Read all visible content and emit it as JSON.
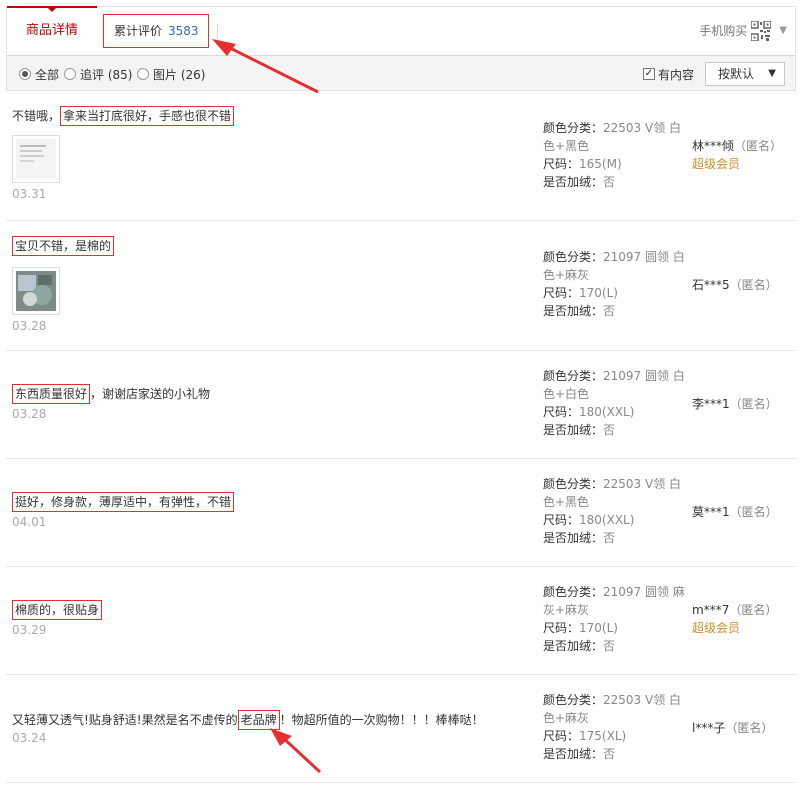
{
  "tabs": {
    "detail_label": "商品详情",
    "review_label": "累计评价",
    "review_count": "3583",
    "mobile_buy": "手机购买"
  },
  "filters": {
    "all": "全部",
    "append": "追评 (85)",
    "pictures": "图片 (26)",
    "has_content": "有内容",
    "sort": "按默认",
    "all_selected": true,
    "has_content_checked": true
  },
  "reviews": [
    {
      "pre": "不错哦，",
      "hl": "拿来当打底很好，手感也很不错",
      "post": "",
      "date": "03.31",
      "color_label": "颜色分类：",
      "color_value": "22503 V领 白色+黑色",
      "size_label": "尺码：",
      "size_value": "165(M)",
      "fleece_label": "是否加绒：",
      "fleece_value": "否",
      "user": "林***倾",
      "anon": "（匿名）",
      "vip": "超级会员"
    },
    {
      "pre": "",
      "hl": "宝贝不错，是棉的",
      "post": "",
      "date": "03.28",
      "color_label": "颜色分类：",
      "color_value": "21097 圆领 白色+麻灰",
      "size_label": "尺码：",
      "size_value": "170(L)",
      "fleece_label": "是否加绒：",
      "fleece_value": "否",
      "user": "石***5",
      "anon": "（匿名）",
      "vip": ""
    },
    {
      "pre": "",
      "hl": "东西质量很好",
      "post": "，谢谢店家送的小礼物",
      "date": "03.28",
      "color_label": "颜色分类：",
      "color_value": "21097 圆领 白色+白色",
      "size_label": "尺码：",
      "size_value": "180(XXL)",
      "fleece_label": "是否加绒：",
      "fleece_value": "否",
      "user": "李***1",
      "anon": "（匿名）",
      "vip": ""
    },
    {
      "pre": "",
      "hl": "挺好，修身款，薄厚适中，有弹性，不错",
      "post": "",
      "date": "04.01",
      "color_label": "颜色分类：",
      "color_value": "22503 V领 白色+黑色",
      "size_label": "尺码：",
      "size_value": "180(XXL)",
      "fleece_label": "是否加绒：",
      "fleece_value": "否",
      "user": "莫***1",
      "anon": "（匿名）",
      "vip": ""
    },
    {
      "pre": "",
      "hl": "棉质的，很贴身",
      "post": "",
      "date": "03.29",
      "color_label": "颜色分类：",
      "color_value": "21097 圆领 麻灰+麻灰",
      "size_label": "尺码：",
      "size_value": "170(L)",
      "fleece_label": "是否加绒：",
      "fleece_value": "否",
      "user": "m***7",
      "anon": "（匿名）",
      "vip": "超级会员"
    },
    {
      "pre": "又轻薄又透气!贴身舒适!果然是名不虚传的",
      "hl": "老品牌",
      "post": "！物超所值的一次购物！！！棒棒哒！",
      "date": "03.24",
      "color_label": "颜色分类：",
      "color_value": "22503 V领 白色+麻灰",
      "size_label": "尺码：",
      "size_value": "175(XL)",
      "fleece_label": "是否加绒：",
      "fleece_value": "否",
      "user": "l***子",
      "anon": "（匿名）",
      "vip": ""
    }
  ],
  "colors": {
    "accent": "#c40000",
    "highlight_border": "#e43130",
    "link_blue": "#3366cc",
    "vip": "#c4922e"
  }
}
